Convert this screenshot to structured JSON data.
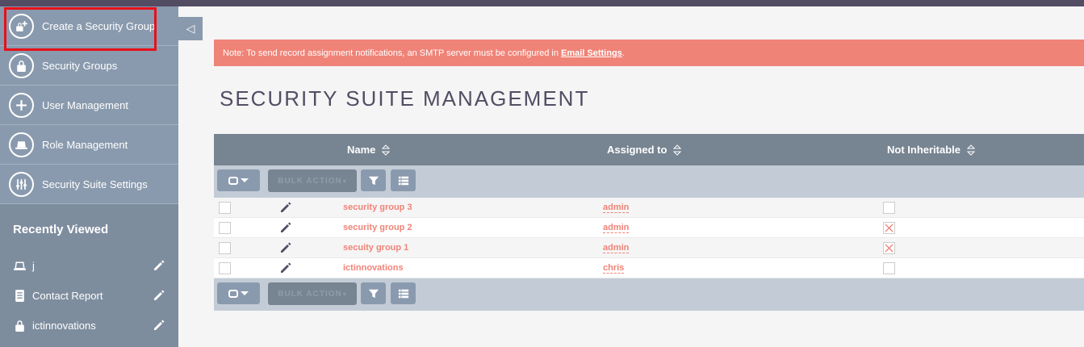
{
  "sidebar": {
    "actions": [
      {
        "label": "Create a Security Group",
        "icon": "lock-plus-icon"
      },
      {
        "label": "Security Groups",
        "icon": "lock-icon"
      },
      {
        "label": "User Management",
        "icon": "plus-icon"
      },
      {
        "label": "Role Management",
        "icon": "role-icon"
      },
      {
        "label": "Security Suite Settings",
        "icon": "sliders-icon"
      }
    ],
    "recently_viewed_title": "Recently Viewed",
    "recently_viewed": [
      {
        "label": "j",
        "icon": "role-icon"
      },
      {
        "label": "Contact Report",
        "icon": "report-icon"
      },
      {
        "label": "ictinnovations",
        "icon": "lock-icon"
      }
    ]
  },
  "notice": {
    "text": "Note: To send record assignment notifications, an SMTP server must be configured in",
    "link": "Email Settings",
    "suffix": "."
  },
  "page_title": "SECURITY SUITE MANAGEMENT",
  "table": {
    "columns": [
      "Name",
      "Assigned to",
      "Not Inheritable"
    ],
    "bulk_action_label": "BULK ACTION",
    "rows": [
      {
        "name": "security group 3",
        "assigned_to": "admin",
        "not_inheritable": false,
        "ni_style": "empty"
      },
      {
        "name": "security group 2",
        "assigned_to": "admin",
        "not_inheritable": false,
        "ni_style": "x"
      },
      {
        "name": "secuity group 1",
        "assigned_to": "admin",
        "not_inheritable": false,
        "ni_style": "x"
      },
      {
        "name": "ictinnovations",
        "assigned_to": "chris",
        "not_inheritable": false,
        "ni_style": "empty"
      }
    ]
  },
  "colors": {
    "sidebar": "#8a9aae",
    "accent": "#f08377",
    "header": "#534d64",
    "table_header": "#778491",
    "highlight": "#e8101a"
  }
}
